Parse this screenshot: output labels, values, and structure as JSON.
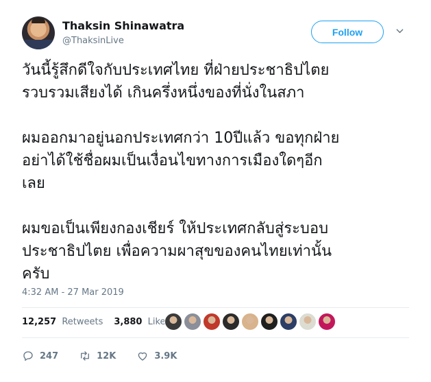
{
  "author": {
    "name": "Thaksin Shinawatra",
    "handle": "@ThaksinLive"
  },
  "follow_button": {
    "label": "Follow"
  },
  "tweet": {
    "paragraphs": [
      "วันนี้รู้สึกดีใจกับประเทศไทย ที่ฝ่ายประชาธิปไตย\nรวบรวมเสียงได้ เกินครึ่งหนึ่งของที่นั่งในสภา",
      "ผมออกมาอยู่นอกประเทศกว่า 10ปีแล้ว ขอทุกฝ่าย\nอย่าได้ใช้ชื่อผมเป็นเงื่อนไขทางการเมืองใดๆอีก\nเลย",
      "ผมขอเป็นเพียงกองเชียร์ ให้ประเทศกลับสู่ระบอบ\nประชาธิปไตย เพื่อความผาสุขของคนไทยเท่านั้น\nครับ"
    ],
    "timestamp": "4:32 AM - 27 Mar 2019"
  },
  "stats": {
    "retweets_count": "12,257",
    "retweets_label": "Retweets",
    "likes_count": "3,880",
    "likes_label": "Likes"
  },
  "liker_avatars": [
    {
      "name": "liker-avatar-1",
      "color": "#3a3a3a"
    },
    {
      "name": "liker-avatar-2",
      "color": "#8a8f99"
    },
    {
      "name": "liker-avatar-3",
      "color": "#c0392b"
    },
    {
      "name": "liker-avatar-4",
      "color": "#2b2b2b"
    },
    {
      "name": "liker-avatar-5",
      "color": "#d9b38c"
    },
    {
      "name": "liker-avatar-6",
      "color": "#1f1f1f"
    },
    {
      "name": "liker-avatar-7",
      "color": "#2c3e66"
    },
    {
      "name": "liker-avatar-8",
      "color": "#dcdcd2"
    },
    {
      "name": "liker-avatar-9",
      "color": "#c2185b"
    }
  ],
  "actions": {
    "replies": "247",
    "retweets": "12K",
    "likes": "3.9K"
  },
  "colors": {
    "accent": "#1da1f2",
    "secondary_text": "#657786",
    "primary_text": "#14171a",
    "divider": "#e6ecf0"
  },
  "icons": {
    "caret": "chevron-down-icon",
    "reply": "reply-icon",
    "retweet": "retweet-icon",
    "like": "heart-icon"
  }
}
